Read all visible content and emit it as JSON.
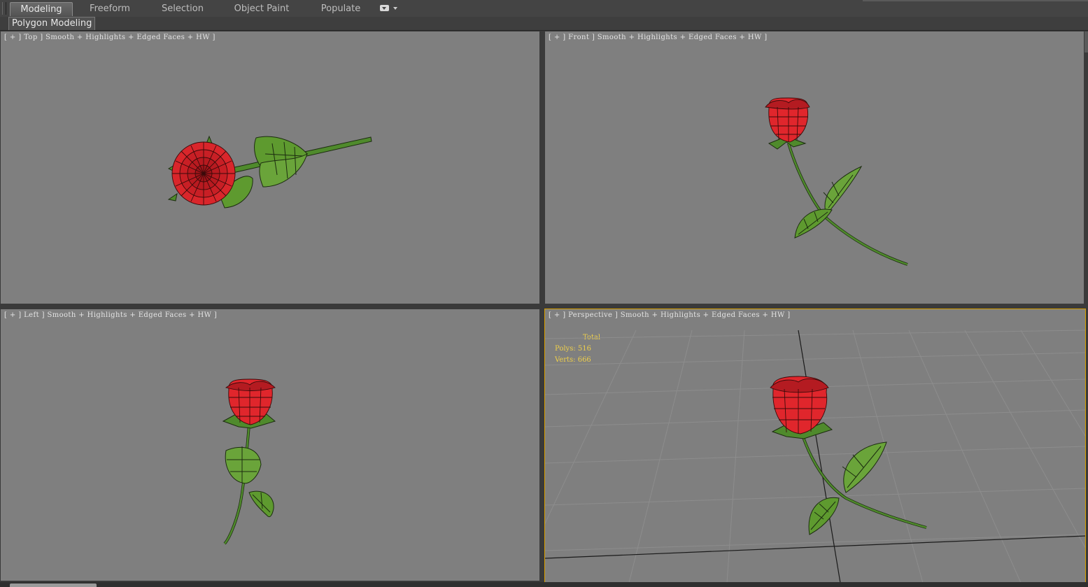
{
  "ribbon": {
    "tabs": [
      {
        "label": "Modeling",
        "active": true
      },
      {
        "label": "Freeform"
      },
      {
        "label": "Selection"
      },
      {
        "label": "Object Paint"
      },
      {
        "label": "Populate"
      }
    ],
    "panel_label": "Polygon Modeling"
  },
  "viewports": {
    "top": {
      "label": "[ + ] Top ] Smooth + Highlights + Edged Faces + HW ]"
    },
    "front": {
      "label": "[ + ] Front ] Smooth + Highlights + Edged Faces + HW ]"
    },
    "left": {
      "label": "[ + ] Left ] Smooth + Highlights + Edged Faces + HW ]"
    },
    "perspective": {
      "label": "[ + ] Perspective ] Smooth + Highlights + Edged Faces + HW ]",
      "stats": {
        "header": "Total",
        "polys": "Polys: 516",
        "verts": "Verts: 666"
      }
    }
  },
  "colors": {
    "viewport_bg": "#7f7f7f",
    "active_viewport_border": "#d9a000",
    "stats_text": "#f0d04a",
    "rose_red": "#e0262c",
    "leaf_green": "#5f9a2e"
  }
}
